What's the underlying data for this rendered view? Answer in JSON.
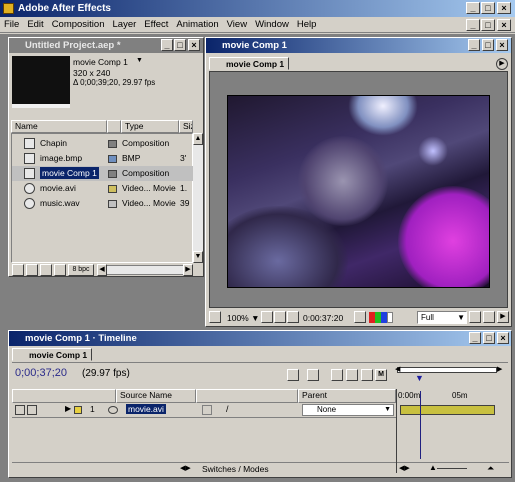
{
  "app": {
    "title": "Adobe After Effects"
  },
  "menu": [
    "File",
    "Edit",
    "Composition",
    "Layer",
    "Effect",
    "Animation",
    "View",
    "Window",
    "Help"
  ],
  "project": {
    "title": "Untitled Project.aep *",
    "preview": {
      "name": "movie Comp 1",
      "dims": "320 x 240",
      "info": "Δ 0;00;39;20, 29.97 fps"
    },
    "columns": {
      "name": "Name",
      "type": "Type",
      "size": "Size"
    },
    "items": [
      {
        "name": "Chapin",
        "type": "Composition",
        "size": "",
        "color": "#808080"
      },
      {
        "name": "image.bmp",
        "type": "BMP",
        "size": "3'",
        "color": "#7090c0"
      },
      {
        "name": "movie Comp 1",
        "type": "Composition",
        "size": "",
        "color": "#808080"
      },
      {
        "name": "movie.avi",
        "type": "Video... Movie",
        "size": "1.",
        "color": "#d0c060"
      },
      {
        "name": "music.wav",
        "type": "Video... Movie",
        "size": "39",
        "color": "#c0c0c0"
      }
    ],
    "bpc": "8 bpc"
  },
  "comp": {
    "title": "movie Comp 1",
    "tab": "movie Comp 1",
    "zoom": "100%",
    "timecode": "0:00:37:20",
    "quality": "Full"
  },
  "timeline": {
    "title": "movie Comp 1 · Timeline",
    "tab": "movie Comp 1",
    "timecode": "0;00;37;20",
    "fps": "(29.97 fps)",
    "headers": {
      "source": "Source Name",
      "parent": "Parent"
    },
    "layer": {
      "num": "1",
      "name": "movie.avi",
      "parent": "None"
    },
    "switches_label": "Switches / Modes",
    "ruler": [
      "0:00m",
      "05m"
    ]
  }
}
